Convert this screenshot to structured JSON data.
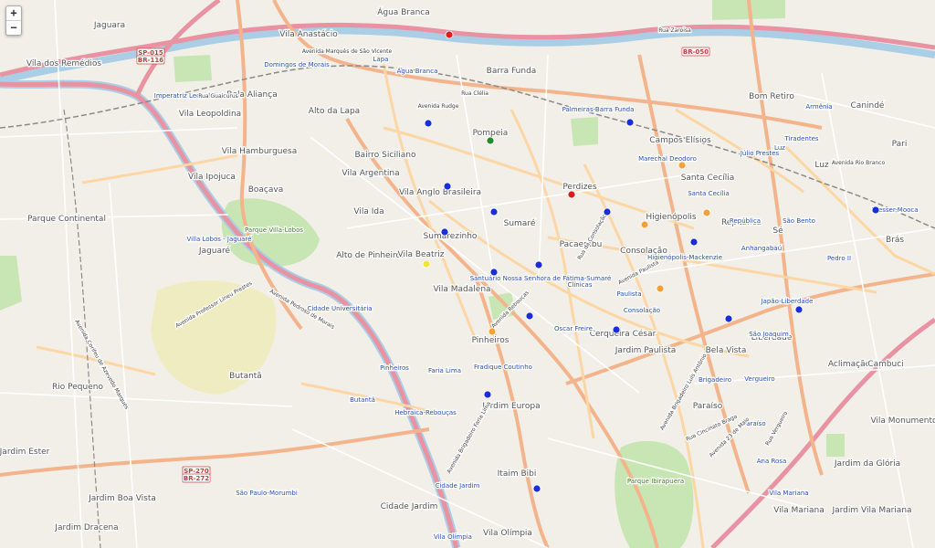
{
  "zoom": {
    "in_label": "+",
    "out_label": "−"
  },
  "colors": {
    "land": "#f2efe9",
    "park": "#c8e6b4",
    "campus": "#f0ecc2",
    "water": "#a9cee5",
    "motorway": "#e892a2",
    "trunk": "#f3b48c",
    "primary": "#fcd6a4",
    "minor": "#ffffff",
    "rail": "#8a8a8a",
    "label_dark": "#555555",
    "label_blue": "#2a4fb8",
    "label_road": "#444444",
    "marker_blue": "#1a2ddb",
    "marker_red": "#e01b1b",
    "marker_orange": "#f3a13c",
    "marker_green": "#1f8c2d",
    "marker_yellow": "#f1e33a"
  },
  "districts": [
    "Jaguara",
    "Vila dos Remédios",
    "Vila Anastácio",
    "Água Branca",
    "Barra Funda",
    "Bom Retiro",
    "Canindé",
    "Pari",
    "Bela Aliança",
    "Alto da Lapa",
    "Vila Leopoldina",
    "Vila Hamburguesa",
    "Bairro Siciliano",
    "Pompeia",
    "Vila Ipojuca",
    "Vila Argentina",
    "Vila Anglo Brasileira",
    "Perdizes",
    "Campos Elísios",
    "Santa Cecília",
    "Higienópolis",
    "Boaçava",
    "Vila Ida",
    "Sumaré",
    "Sumarezinho",
    "Pacaembu",
    "Consolação",
    "Parque Continental",
    "Jaguaré",
    "Alto de Pinheiros",
    "Vila Beatriz",
    "Vila Madalena",
    "Pinheiros",
    "Cerqueira César",
    "Jardim Paulista",
    "Bela Vista",
    "Liberdade",
    "Aclimação",
    "Cambuci",
    "Rio Pequeno",
    "Butantã",
    "Jardim Europa",
    "Paraíso",
    "Vila Monumento",
    "Jardim Ester",
    "Jardim Boa Vista",
    "Itaim Bibi",
    "Jardim da Glória",
    "Jardim Dracena",
    "Cidade Jardim",
    "Vila Olímpia",
    "Vila Mariana",
    "Jardim Vila Mariana",
    "Sé",
    "República",
    "Brás",
    "Luz"
  ],
  "stations": [
    "Lapa",
    "Água Branca",
    "Palmeiras-Barra Funda",
    "Marechal Deodoro",
    "Santa Cecília",
    "República",
    "São Bento",
    "Anhangabaú",
    "Armênia",
    "Tiradentes",
    "Luz",
    "Júlio Prestes",
    "Domingos de Morais",
    "Imperatriz Leopoldina",
    "Villa Lobos - Jaguaré",
    "Cidade Universitária",
    "Pinheiros",
    "Faria Lima",
    "Fradique Coutinho",
    "Oscar Freire",
    "Clínicas",
    "Paulista",
    "Consolação",
    "Higienópolis-Mackenzie",
    "Japão-Liberdade",
    "São Joaquim",
    "Brigadeiro",
    "Vergueiro",
    "Paraíso",
    "Ana Rosa",
    "Butantã",
    "Hebraica-Rebouças",
    "Cidade Jardim",
    "Vila Olímpia",
    "São Paulo-Morumbi",
    "Vila Mariana",
    "Santuário Nossa Senhora de Fátima-Sumaré",
    "Pedro II",
    "Bresser-Mooca"
  ],
  "parks": [
    "Parque Villa-Lobos",
    "Parque Ibirapuera"
  ],
  "roads": [
    "Avenida Marquês de São Vicente",
    "Rua Guaicurus",
    "Rua Clélia",
    "Rua Cincinato Braga",
    "Avenida Paulista",
    "Avenida Brigadeiro Luís Antônio",
    "Rua Vergueiro",
    "Avenida 23 de Maio",
    "Avenida Rebouças",
    "Avenida Brigadeiro Faria Lima",
    "Avenida Pedroso de Morais",
    "Avenida Professor Lineu Prestes",
    "Avenida Corifeu de Azevedo Marques",
    "Rua Zaroisa",
    "Avenida Rudge",
    "Avenida Rio Branco",
    "Rua da Consolação"
  ],
  "shields": [
    "SP-015",
    "BR-116",
    "BR-050",
    "SP-270",
    "BR-272"
  ],
  "markers": [
    {
      "color": "red"
    },
    {
      "color": "green"
    },
    {
      "color": "red"
    },
    {
      "color": "orange"
    },
    {
      "color": "orange"
    },
    {
      "color": "orange"
    },
    {
      "color": "yellow"
    },
    {
      "color": "orange"
    },
    {
      "color": "orange"
    },
    {
      "color": "blue"
    },
    {
      "color": "blue"
    },
    {
      "color": "blue"
    },
    {
      "color": "blue"
    },
    {
      "color": "blue"
    },
    {
      "color": "blue"
    },
    {
      "color": "blue"
    },
    {
      "color": "blue"
    },
    {
      "color": "blue"
    },
    {
      "color": "blue"
    },
    {
      "color": "blue"
    },
    {
      "color": "blue"
    },
    {
      "color": "blue"
    },
    {
      "color": "blue"
    },
    {
      "color": "blue"
    },
    {
      "color": "blue"
    }
  ]
}
